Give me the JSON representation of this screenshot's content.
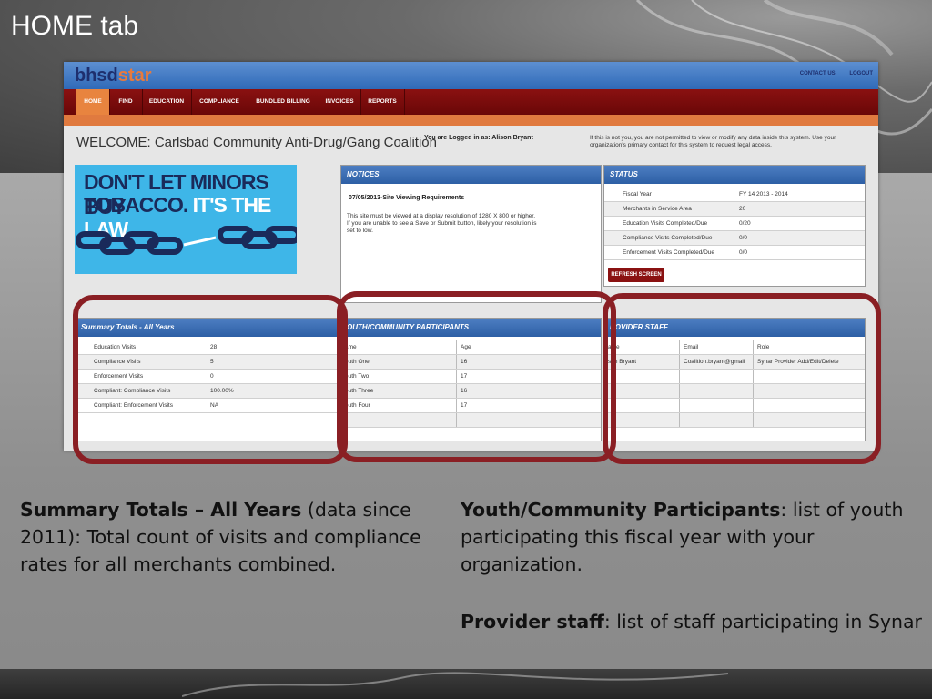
{
  "slide": {
    "title": "HOME tab",
    "caption_left_bold": "Summary Totals – All Years",
    "caption_left_rest": " (data since 2011): Total count of visits and compliance rates for all merchants combined.",
    "caption_right1_bold": "Youth/Community Participants",
    "caption_right1_rest": ": list of youth participating this fiscal year with your organization.",
    "caption_right2_bold": "Provider staff",
    "caption_right2_rest": ": list of staff participating in Synar"
  },
  "app": {
    "logo_part1": "bhsd",
    "logo_part2": "star",
    "top_links": [
      "CONTACT US",
      "LOGOUT"
    ],
    "nav": [
      "HOME",
      "FIND",
      "EDUCATION",
      "COMPLIANCE",
      "BUNDLED BILLING",
      "INVOICES",
      "REPORTS"
    ],
    "welcome": "WELCOME: Carlsbad Community Anti-Drug/Gang Coalition",
    "logged_in": "You are Logged in as: Alison Bryant",
    "warning": "If this is not you, you are not permitted to view or modify any data inside this system. Use your organization's primary contact for this system to request legal access.",
    "banner_line1": "DON'T LET MINORS BUY",
    "banner_line2a": "TOBACCO.",
    "banner_line2b": " IT'S THE LAW.",
    "notices": {
      "title": "NOTICES",
      "item_title": "07/05/2013-Site Viewing Requirements",
      "item_body": "This site must be viewed at a display resolution of 1280 X 800 or higher. If you are unable to see a Save or Submit button, likely your resolution is set to low."
    },
    "status": {
      "title": "STATUS",
      "rows": [
        {
          "label": "Fiscal Year",
          "value": "FY 14   2013 - 2014"
        },
        {
          "label": "Merchants in Service Area",
          "value": "20"
        },
        {
          "label": "Education Visits Completed/Due",
          "value": "0/20"
        },
        {
          "label": "Compliance Visits Completed/Due",
          "value": "0/0"
        },
        {
          "label": "Enforcement Visits Completed/Due",
          "value": "0/0"
        }
      ],
      "refresh": "REFRESH SCREEN"
    },
    "summary": {
      "title": "Summary Totals - All Years",
      "rows": [
        {
          "label": "Education Visits",
          "value": "28"
        },
        {
          "label": "Compliance Visits",
          "value": "5"
        },
        {
          "label": "Enforcement Visits",
          "value": "0"
        },
        {
          "label": "Compliant: Compliance Visits",
          "value": "100.00%"
        },
        {
          "label": "Compliant: Enforcement Visits",
          "value": "NA"
        }
      ]
    },
    "youth": {
      "title": "OUTH/COMMUNITY PARTICIPANTS",
      "headers": [
        "ame",
        "Age"
      ],
      "rows": [
        {
          "name": "outh One",
          "age": "16"
        },
        {
          "name": "outh Two",
          "age": "17"
        },
        {
          "name": "outh Three",
          "age": "16"
        },
        {
          "name": "outh Four",
          "age": "17"
        }
      ]
    },
    "staff": {
      "title": "ROVIDER STAFF",
      "headers": [
        "ame",
        "Email",
        "Role"
      ],
      "rows": [
        {
          "name": "son Bryant",
          "email": "Coalition.bryant@gmail",
          "role": "Synar Provider Add/Edit/Delete"
        }
      ]
    }
  }
}
